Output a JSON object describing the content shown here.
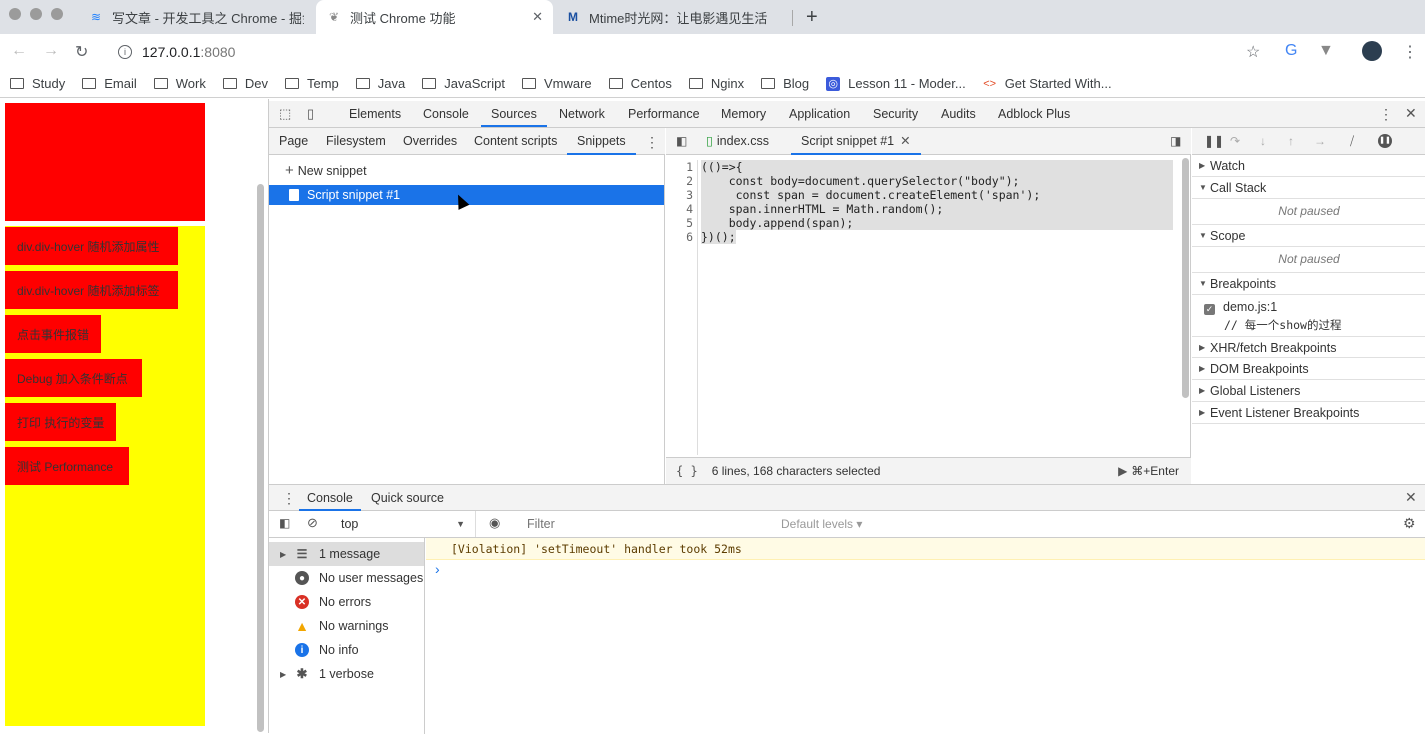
{
  "browser": {
    "tabs": [
      {
        "title": "写文章 - 开发工具之 Chrome - 掘金"
      },
      {
        "title": "测试 Chrome 功能",
        "close": "✕"
      },
      {
        "title": "Mtime时光网：让电影遇见生活"
      }
    ],
    "new_tab": "+",
    "url_host": "127.0.0.1",
    "url_port": ":8080",
    "bookmarks": [
      "Study",
      "Email",
      "Work",
      "Dev",
      "Temp",
      "Java",
      "JavaScript",
      "Vmware",
      "Centos",
      "Nginx",
      "Blog"
    ],
    "bookmark_links": [
      "Lesson 11 - Moder...",
      "Get Started With..."
    ]
  },
  "page": {
    "buttons": [
      "div.div-hover 随机添加属性",
      "div.div-hover 随机添加标签",
      "点击事件报错",
      "Debug 加入条件断点",
      "打印 执行的变量",
      "测试 Performance"
    ]
  },
  "devtools": {
    "main_tabs": [
      "Elements",
      "Console",
      "Sources",
      "Network",
      "Performance",
      "Memory",
      "Application",
      "Security",
      "Audits",
      "Adblock Plus"
    ],
    "active_main_tab": "Sources",
    "nav_tabs": [
      "Page",
      "Filesystem",
      "Overrides",
      "Content scripts",
      "Snippets"
    ],
    "new_snippet": "New snippet",
    "snippet_item": "Script snippet #1",
    "editor_tabs": [
      "index.css",
      "Script snippet #1"
    ],
    "code_lines": [
      "(()=>{",
      "    const body=document.querySelector(\"body\");",
      "     const span = document.createElement('span');",
      "    span.innerHTML = Math.random();",
      "    body.append(span);",
      "})();"
    ],
    "line_numbers": [
      "1",
      "2",
      "3",
      "4",
      "5",
      "6"
    ],
    "status": "6 lines, 168 characters selected",
    "run_hint": "⌘+Enter",
    "format_icon": "{ }",
    "debugger": {
      "watch": "Watch",
      "call_stack": "Call Stack",
      "not_paused": "Not paused",
      "scope": "Scope",
      "breakpoints": "Breakpoints",
      "bp_file": "demo.js:1",
      "bp_code": "// 每一个show的过程",
      "xhr": "XHR/fetch Breakpoints",
      "dom": "DOM Breakpoints",
      "global": "Global Listeners",
      "event": "Event Listener Breakpoints"
    },
    "drawer": {
      "tabs": [
        "Console",
        "Quick source"
      ],
      "context": "top",
      "filter_placeholder": "Filter",
      "levels": "Default levels ▾",
      "sidebar": [
        "1 message",
        "No user messages",
        "No errors",
        "No warnings",
        "No info",
        "1 verbose"
      ],
      "message": "[Violation] 'setTimeout' handler took 52ms",
      "prompt": "›"
    }
  }
}
